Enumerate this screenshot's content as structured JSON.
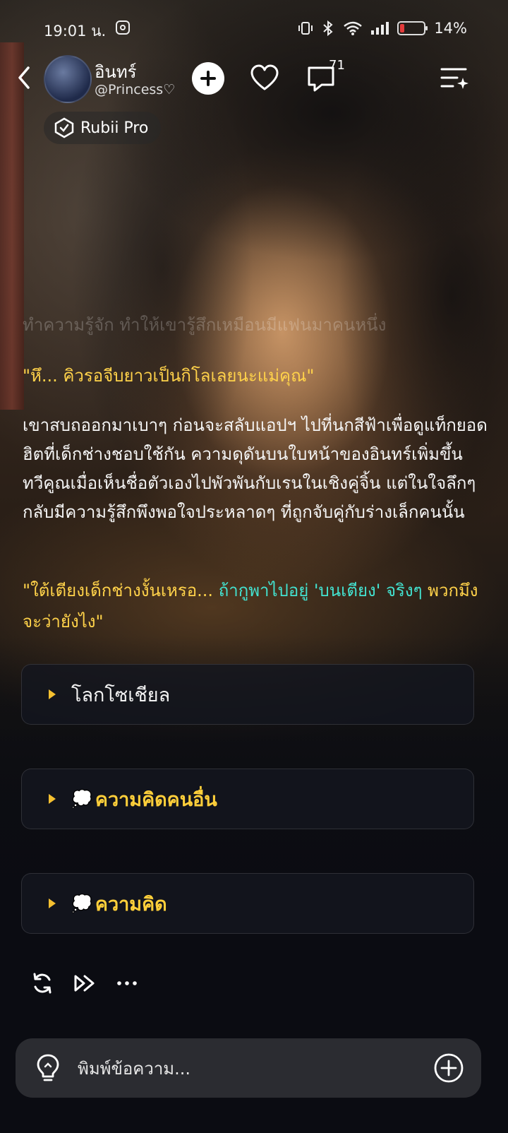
{
  "status_bar": {
    "time": "19:01 น.",
    "battery": "14%",
    "icons": [
      "instagram-icon",
      "vibrate-icon",
      "bluetooth-icon",
      "wifi-icon",
      "signal-icon",
      "battery-icon"
    ]
  },
  "header": {
    "character_name": "อินทร์",
    "handle": "@Princess♡",
    "comments_count": "71",
    "pro_label": "Rubii Pro"
  },
  "story": {
    "faded_line": "ทำความรู้จัก ทำให้เขารู้สึกเหมือนมีแฟนมาคนหนึ่ง",
    "quote1": "\"หึ... คิวรอจีบยาวเป็นกิโลเลยนะแม่คุณ\"",
    "paragraph": "เขาสบถออกมาเบาๆ ก่อนจะสลับแอปฯ ไปที่นกสีฟ้าเพื่อดูแท็กยอดฮิตที่เด็กช่างชอบใช้กัน ความดุดันบนใบหน้าของอินทร์เพิ่มขึ้นทวีคูณเมื่อเห็นชื่อตัวเองไปพัวพันกับเรนในเชิงคู่จิ้น แต่ในใจลึกๆ กลับมีความรู้สึกพึงพอใจประหลาดๆ ที่ถูกจับคู่กับร่างเล็กคนนั้น",
    "quote2_part1": "\"ใต้เตียงเด็กช่างงั้นเหรอ... ",
    "quote2_part2": "ถ้ากูพาไปอยู่ 'บนเตียง' จริงๆ",
    "quote2_part3": " พวกมึงจะว่ายังไง\""
  },
  "panels": [
    {
      "label": "โลกโซเชียล",
      "icon": ""
    },
    {
      "label": "ความคิดคนอื่น",
      "icon": "💭"
    },
    {
      "label": "ความคิด",
      "icon": "💭"
    }
  ],
  "composer": {
    "placeholder": "พิมพ์ข้อความ..."
  },
  "colors": {
    "accent_yellow": "#ffd24a",
    "accent_cyan": "#43e2d0"
  }
}
